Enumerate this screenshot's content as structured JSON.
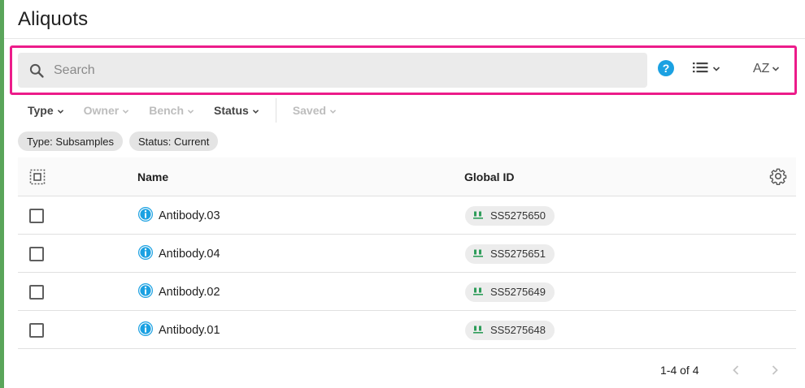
{
  "page": {
    "title": "Aliquots"
  },
  "search": {
    "placeholder": "Search"
  },
  "toolbar": {
    "sort_label": "AZ"
  },
  "filters": [
    {
      "label": "Type",
      "active": true
    },
    {
      "label": "Owner",
      "active": false
    },
    {
      "label": "Bench",
      "active": false
    },
    {
      "label": "Status",
      "active": true
    },
    {
      "label": "Saved",
      "active": false
    }
  ],
  "chips": [
    "Type: Subsamples",
    "Status: Current"
  ],
  "table": {
    "columns": {
      "name": "Name",
      "global_id": "Global ID"
    },
    "rows": [
      {
        "name": "Antibody.03",
        "global_id": "SS5275650"
      },
      {
        "name": "Antibody.04",
        "global_id": "SS5275651"
      },
      {
        "name": "Antibody.02",
        "global_id": "SS5275649"
      },
      {
        "name": "Antibody.01",
        "global_id": "SS5275648"
      }
    ]
  },
  "pagination": {
    "range_label": "1-4 of 4"
  },
  "colors": {
    "accent_pink": "#ec1c8a",
    "help_blue": "#1ba1e2",
    "info_blue": "#1ba1e2",
    "gid_green": "#2e9d5a",
    "left_bar_green": "#5aa55a"
  },
  "icons": {
    "search": "search-icon",
    "help": "help-icon",
    "view": "list-view-icon",
    "settings": "gear-icon",
    "info": "info-icon",
    "global_id": "subsample-icon",
    "prev": "chevron-left-icon",
    "next": "chevron-right-icon"
  }
}
